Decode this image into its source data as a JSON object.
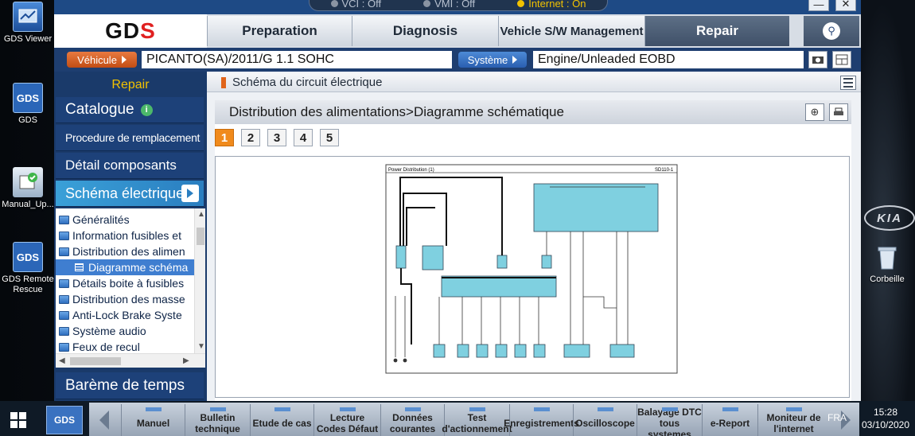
{
  "desktop": {
    "icons_left": [
      {
        "label": "GDS Viewer"
      },
      {
        "label": "GDS",
        "glyph": "GDS"
      },
      {
        "label": "Manual_Up..."
      },
      {
        "label": "GDS Remote Rescue",
        "glyph": "GDS"
      }
    ],
    "icons_right": [
      {
        "label": "Corbeille"
      }
    ],
    "wallpaper_brand": "KIA"
  },
  "window": {
    "status": {
      "vci": "VCI : Off",
      "vmi": "VMI : Off",
      "internet": "Internet : On"
    },
    "controls": {
      "minimize": "—",
      "close": "✕"
    },
    "nav": {
      "logo_left": "GD",
      "logo_right": "S",
      "tabs": [
        {
          "label": "Preparation"
        },
        {
          "label": "Diagnosis"
        },
        {
          "label": "Vehicle S/W Management"
        },
        {
          "label": "Repair",
          "active": true
        }
      ]
    },
    "vehicle_bar": {
      "vehicle_btn": "Véhicule",
      "vehicle_value": "PICANTO(SA)/2011/G 1.1 SOHC",
      "system_btn": "Système",
      "system_value": "Engine/Unleaded EOBD"
    },
    "sidebar": {
      "header": "Repair",
      "items": [
        {
          "label": "Catalogue",
          "info": "i"
        },
        {
          "label": "Procedure de remplacement"
        },
        {
          "label": "Détail composants"
        },
        {
          "label": "Schéma électrique",
          "active": true
        }
      ],
      "tree": [
        {
          "label": "Généralités"
        },
        {
          "label": "Information fusibles et"
        },
        {
          "label": "Distribution des alimen"
        },
        {
          "label": "Diagramme schéma",
          "selected": true,
          "child": true
        },
        {
          "label": "Détails boite à fusibles"
        },
        {
          "label": "Distribution des masse"
        },
        {
          "label": "Anti-Lock Brake Syste"
        },
        {
          "label": "Système audio"
        },
        {
          "label": "Feux de recul"
        }
      ],
      "bottom_item": "Barème de temps"
    },
    "content": {
      "header": "Schéma du circuit électrique",
      "breadcrumb": "Distribution des alimentations>Diagramme schématique",
      "pages": [
        "1",
        "2",
        "3",
        "4",
        "5"
      ],
      "current_page": "1",
      "diagram": {
        "title": "Power Distribution (1)",
        "code": "SD110-1"
      }
    }
  },
  "taskbar": {
    "app": "GDS",
    "buttons": [
      "Manuel",
      "Bulletin technique",
      "Etude de cas",
      "Lecture Codes Défaut",
      "Données courantes",
      "Test d'actionnement",
      "Enregistrements",
      "Oscilloscope",
      "Balayage DTC tous systemes",
      "e-Report",
      "Moniteur de l'internet"
    ],
    "lang": "FRA",
    "time": "15:28",
    "date": "03/10/2020"
  },
  "colors": {
    "accent_orange": "#f08a1c",
    "nav_blue": "#1a3a6a",
    "active_blue": "#3aa0d8",
    "diagram_cyan": "#7fd0e0",
    "repair_yellow": "#f2c200"
  }
}
